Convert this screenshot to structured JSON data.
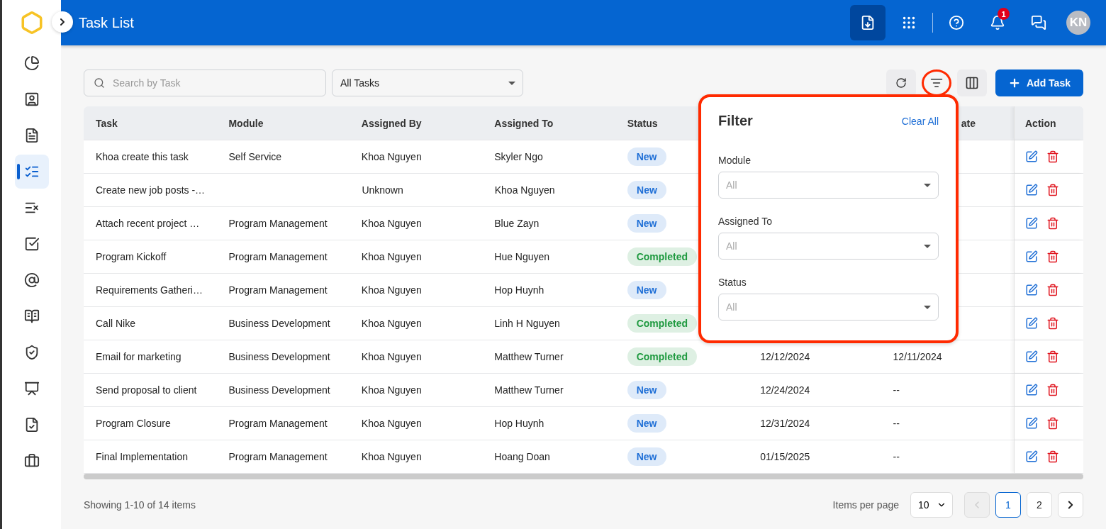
{
  "header": {
    "title": "Task List",
    "notifications": "1",
    "avatar": "KN"
  },
  "sidebar": {
    "items": [
      {
        "selected": false
      },
      {
        "selected": false
      },
      {
        "selected": false
      },
      {
        "selected": true
      },
      {
        "selected": false
      },
      {
        "selected": false
      },
      {
        "selected": false
      },
      {
        "selected": false
      },
      {
        "selected": false
      },
      {
        "selected": false
      },
      {
        "selected": false
      },
      {
        "selected": false
      }
    ]
  },
  "toolbar": {
    "search_placeholder": "Search by Task",
    "task_scope": "All Tasks",
    "add_button": "Add Task"
  },
  "table": {
    "columns": [
      "Task",
      "Module",
      "Assigned By",
      "Assigned To",
      "Status",
      "",
      "ate",
      "Action"
    ],
    "rows": [
      {
        "task": "Khoa create this task",
        "module": "Self Service",
        "assigned_by": "Khoa Nguyen",
        "assigned_to": "Skyler Ngo",
        "status": "New",
        "color": "#1f6fd6"
      },
      {
        "task": "Create new job posts -…",
        "module": "",
        "assigned_by": "Unknown",
        "assigned_to": "Khoa Nguyen",
        "status": "New",
        "color": "#1f6fd6"
      },
      {
        "task": "Attach recent project …",
        "module": "Program Management",
        "assigned_by": "Khoa Nguyen",
        "assigned_to": "Blue Zayn",
        "status": "New",
        "color": "#1f6fd6"
      },
      {
        "task": "Program Kickoff",
        "module": "Program Management",
        "assigned_by": "Khoa Nguyen",
        "assigned_to": "Hue Nguyen",
        "status": "Completed",
        "color": "#1f9a40"
      },
      {
        "task": "Requirements Gatheri…",
        "module": "Program Management",
        "assigned_by": "Khoa Nguyen",
        "assigned_to": "Hop Huynh",
        "status": "New",
        "color": "#1f6fd6"
      },
      {
        "task": "Call Nike",
        "module": "Business Development",
        "assigned_by": "Khoa Nguyen",
        "assigned_to": "Linh H Nguyen",
        "status": "Completed",
        "color": "#1f9a40"
      },
      {
        "task": "Email for marketing",
        "module": "Business Development",
        "assigned_by": "Khoa Nguyen",
        "assigned_to": "Matthew Turner",
        "status": "Completed",
        "color": "#1f9a40",
        "column_6": "12/12/2024",
        "column_7": "12/11/2024"
      },
      {
        "task": "Send proposal to client",
        "module": "Business Development",
        "assigned_by": "Khoa Nguyen",
        "assigned_to": "Matthew Turner",
        "status": "New",
        "color": "#1f6fd6",
        "column_6": "12/24/2024",
        "column_7": "--"
      },
      {
        "task": "Program Closure",
        "module": "Program Management",
        "assigned_by": "Khoa Nguyen",
        "assigned_to": "Hop Huynh",
        "status": "New",
        "color": "#1f6fd6",
        "column_6": "12/31/2024",
        "column_7": "--"
      },
      {
        "task": "Final Implementation",
        "module": "Program Management",
        "assigned_by": "Khoa Nguyen",
        "assigned_to": "Hoang Doan",
        "status": "New",
        "color": "#1f6fd6",
        "column_6": "01/15/2025",
        "column_7": "--"
      }
    ]
  },
  "filter": {
    "title": "Filter",
    "clear": "Clear All",
    "fields": [
      {
        "label": "Module",
        "placeholder": "All"
      },
      {
        "label": "Assigned To",
        "placeholder": "All"
      },
      {
        "label": "Status",
        "placeholder": "All"
      }
    ]
  },
  "footer": {
    "summary": "Showing 1-10 of 14 items",
    "per_page_label": "Items per page",
    "per_page": "10",
    "prev_disabled": true,
    "pages": [
      {
        "label": "1",
        "selected": true
      },
      {
        "label": "2",
        "selected": false
      }
    ]
  }
}
